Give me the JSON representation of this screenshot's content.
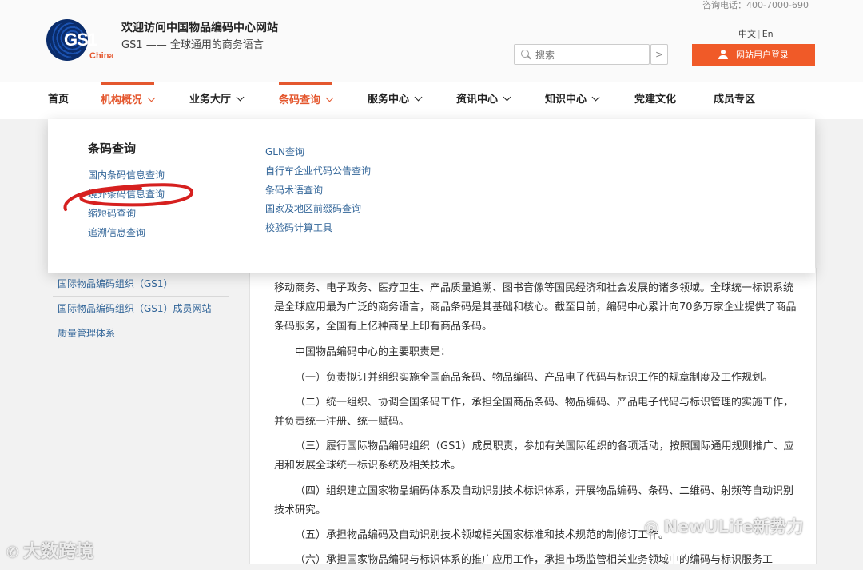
{
  "header": {
    "hotline": "咨询电话：400-7000-690",
    "logo_text": "GS1",
    "logo_country": "China",
    "welcome": "欢迎访问中国物品编码中心网站",
    "slogan": "GS1 —— 全球通用的商务语言",
    "lang_zh": "中文",
    "lang_en": "En",
    "search_placeholder": "搜索",
    "search_button": ">",
    "login_label": "网站用户登录",
    "accent_color": "#f05a28"
  },
  "nav": {
    "items": [
      {
        "label": "首页"
      },
      {
        "label": "机构概况"
      },
      {
        "label": "业务大厅"
      },
      {
        "label": "条码查询"
      },
      {
        "label": "服务中心"
      },
      {
        "label": "资讯中心"
      },
      {
        "label": "知识中心"
      },
      {
        "label": "党建文化"
      },
      {
        "label": "成员专区"
      }
    ]
  },
  "dropdown": {
    "title": "条码查询",
    "col1": [
      "国内条码信息查询",
      "境外条码信息查询",
      "缩短码查询",
      "追溯信息查询"
    ],
    "col2": [
      "GLN查询",
      "自行车企业代码公告查询",
      "条码术语查询",
      "国家及地区前缀码查询",
      "校验码计算工具"
    ]
  },
  "sidebar": {
    "items": [
      "国际物品编码组织（GS1）",
      "国际物品编码组织（GS1）成员网站",
      "质量管理体系"
    ]
  },
  "content": {
    "paragraphs": [
      "移动商务、电子政务、医疗卫生、产品质量追溯、图书音像等国民经济和社会发展的诸多领域。全球统一标识系统是全球应用最为广泛的商务语言，商品条码是其基础和核心。截至目前，编码中心累计向70多万家企业提供了商品条码服务，全国有上亿种商品上印有商品条码。",
      "中国物品编码中心的主要职责是：",
      "（一）负责拟订并组织实施全国商品条码、物品编码、产品电子代码与标识工作的规章制度及工作规划。",
      "（二）统一组织、协调全国条码工作，承担全国商品条码、物品编码、产品电子代码与标识管理的实施工作，并负责统一注册、统一赋码。",
      "（三）履行国际物品编码组织（GS1）成员职责，参加有关国际组织的各项活动，按照国际通用规则推广、应用和发展全球统一标识系统及相关技术。",
      "（四）组织建立国家物品编码体系及自动识别技术标识体系，开展物品编码、条码、二维码、射频等自动识别技术研究。",
      "（五）承担物品编码及自动识别技术领域相关国家标准和技术规范的制修订工作。",
      "（六）承担国家物品编码与标识体系的推广应用工作，承担市场监管相关业务领域中的编码与标识服务工"
    ]
  },
  "watermarks": {
    "left": "大数跨境",
    "right": "NewULife新势力"
  }
}
